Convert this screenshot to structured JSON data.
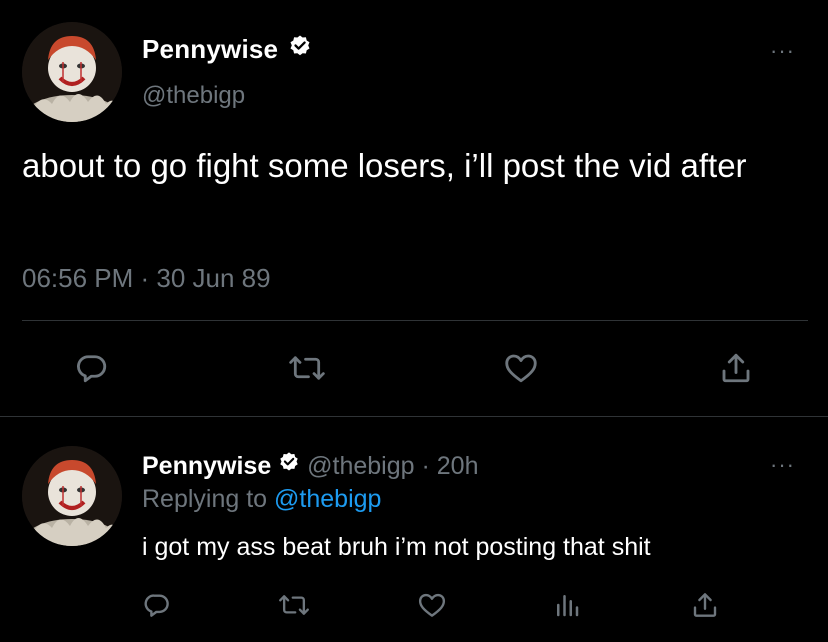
{
  "main_tweet": {
    "author_name": "Pennywise",
    "handle": "@thebigp",
    "text": "about to go fight some losers, i’ll post the vid after",
    "timestamp": "06:56 PM · 30 Jun 89",
    "more_label": "···",
    "actions": [
      "reply-icon",
      "retweet-icon",
      "like-icon",
      "share-icon"
    ]
  },
  "reply_tweet": {
    "author_name": "Pennywise",
    "handle": "@thebigp",
    "separator": "·",
    "time": "20h",
    "replying_prefix": "Replying to",
    "replying_to": "@thebigp",
    "text": "i got my ass beat bruh i’m not posting that shit",
    "more_label": "···",
    "actions": [
      "reply-icon",
      "retweet-icon",
      "like-icon",
      "analytics-icon",
      "share-icon"
    ]
  },
  "colors": {
    "background": "#000000",
    "text": "#ffffff",
    "secondary": "#6e767d",
    "accent": "#1d9bf0",
    "divider": "#2f3336"
  }
}
